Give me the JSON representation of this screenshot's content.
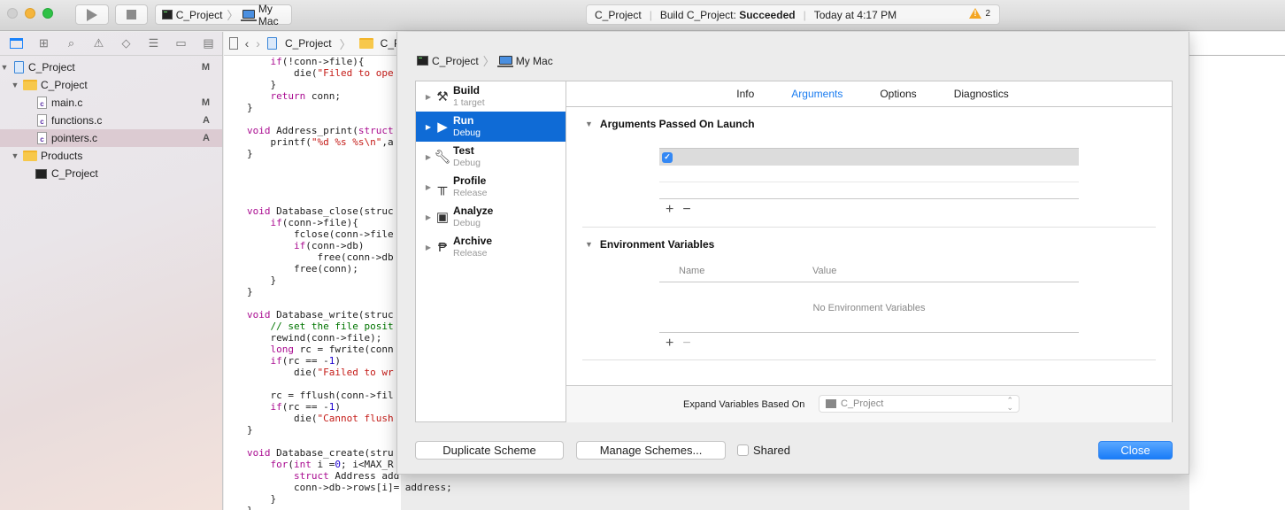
{
  "toolbar": {
    "scheme_name": "C_Project",
    "destination": "My Mac",
    "activity": {
      "project": "C_Project",
      "status_prefix": "Build C_Project: ",
      "status_result": "Succeeded",
      "time": "Today at 4:17 PM",
      "warning_count": "2"
    }
  },
  "navigator": {
    "tabs": [
      "project-navigator",
      "symbol-navigator",
      "find-navigator",
      "issue-navigator",
      "test-navigator",
      "debug-navigator",
      "breakpoint-navigator",
      "report-navigator"
    ],
    "tree": [
      {
        "label": "C_Project",
        "badge": "M",
        "type": "project"
      },
      {
        "label": "C_Project",
        "badge": "",
        "type": "folder"
      },
      {
        "label": "main.c",
        "badge": "M",
        "type": "cfile"
      },
      {
        "label": "functions.c",
        "badge": "A",
        "type": "cfile"
      },
      {
        "label": "pointers.c",
        "badge": "A",
        "type": "cfile",
        "selected": true
      },
      {
        "label": "Products",
        "badge": "",
        "type": "folder"
      },
      {
        "label": "C_Project",
        "badge": "",
        "type": "executable"
      }
    ]
  },
  "editor": {
    "jumpbar": {
      "project": "C_Project",
      "folder": "C_P"
    },
    "code": [
      "    if(!conn->file){",
      "        die(\"Filed to ope",
      "    }",
      "    return conn;",
      "}",
      "",
      "void Address_print(struct",
      "    printf(\"%d %s %s\\n\",a",
      "}",
      "",
      "",
      "",
      "",
      "void Database_close(struc",
      "    if(conn->file){",
      "        fclose(conn->file",
      "        if(conn->db)",
      "            free(conn->db",
      "        free(conn);",
      "    }",
      "}",
      "",
      "void Database_write(struc",
      "    // set the file posit",
      "    rewind(conn->file);",
      "    long rc = fwrite(conn",
      "    if(rc == -1)",
      "        die(\"Failed to wr",
      "",
      "    rc = fflush(conn->fil",
      "    if(rc == -1)",
      "        die(\"Cannot flush",
      "}",
      "",
      "void Database_create(stru",
      "    for(int i =0; i<MAX_R",
      "        struct Address add",
      "        conn->db->rows[i]= address;",
      "    }",
      "}"
    ]
  },
  "sheet": {
    "breadcrumb": {
      "scheme": "C_Project",
      "destination": "My Mac"
    },
    "actions": [
      {
        "name": "Build",
        "sub": "1 target",
        "icon": "hammer-icon"
      },
      {
        "name": "Run",
        "sub": "Debug",
        "icon": "play-icon",
        "selected": true
      },
      {
        "name": "Test",
        "sub": "Debug",
        "icon": "wrench-icon"
      },
      {
        "name": "Profile",
        "sub": "Release",
        "icon": "caliper-icon"
      },
      {
        "name": "Analyze",
        "sub": "Debug",
        "icon": "analyze-icon"
      },
      {
        "name": "Archive",
        "sub": "Release",
        "icon": "archive-icon"
      }
    ],
    "tabs": [
      "Info",
      "Arguments",
      "Options",
      "Diagnostics"
    ],
    "active_tab": "Arguments",
    "arguments_section": {
      "title": "Arguments Passed On Launch",
      "rows": [
        {
          "enabled": true,
          "value": ""
        }
      ]
    },
    "env_section": {
      "title": "Environment Variables",
      "col_name": "Name",
      "col_value": "Value",
      "empty_text": "No Environment Variables"
    },
    "expand_label": "Expand Variables Based On",
    "expand_value": "C_Project",
    "duplicate_label": "Duplicate Scheme",
    "manage_label": "Manage Schemes...",
    "shared_label": "Shared",
    "shared_checked": false,
    "close_label": "Close"
  },
  "colors": {
    "accent": "#1a7cf0",
    "selection": "#0f6bd6",
    "warning": "#f4a623"
  }
}
